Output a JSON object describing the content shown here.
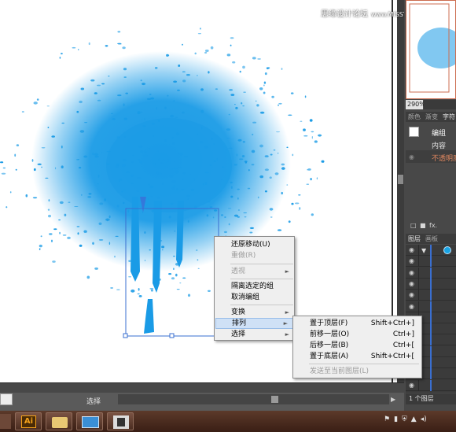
{
  "watermark": {
    "cn": "思缘设计论坛",
    "url": "www.MISSYUAN.COM"
  },
  "navigator": {
    "zoom": "290%"
  },
  "attributes_panel": {
    "tabs": [
      "颜色",
      "渐变",
      "字符",
      "字符"
    ],
    "group_label": "编组",
    "content_label": "内容",
    "opacity_label": "不透明度",
    "bottom_icons": [
      "□",
      "■",
      "fx."
    ]
  },
  "layers_panel": {
    "tabs": [
      "图层",
      "画板"
    ],
    "footer": "1 个图层"
  },
  "status_bar": {
    "tool": "选择"
  },
  "context_menu": {
    "items": [
      {
        "label": "还原移动(U)",
        "disabled": false
      },
      {
        "label": "重做(R)",
        "disabled": true
      },
      {
        "label": "透视",
        "disabled": true,
        "has_submenu": true
      },
      {
        "label": "隔离选定的组",
        "disabled": false
      },
      {
        "label": "取消编组",
        "disabled": false
      },
      {
        "label": "变换",
        "disabled": false,
        "has_submenu": true
      },
      {
        "label": "排列",
        "disabled": false,
        "has_submenu": true,
        "highlighted": true
      },
      {
        "label": "选择",
        "disabled": false,
        "has_submenu": true
      }
    ],
    "submenu_arrow": "►"
  },
  "arrange_submenu": {
    "items": [
      {
        "label": "置于顶层(F)",
        "shortcut": "Shift+Ctrl+]"
      },
      {
        "label": "前移一层(O)",
        "shortcut": "Ctrl+]"
      },
      {
        "label": "后移一层(B)",
        "shortcut": "Ctrl+["
      },
      {
        "label": "置于底层(A)",
        "shortcut": "Shift+Ctrl+["
      },
      {
        "label": "发送至当前图层(L)",
        "shortcut": "",
        "disabled": true
      }
    ]
  },
  "taskbar": {
    "apps": [
      "illustrator-app-icon",
      "folder-icon",
      "screen-app-icon",
      "photo-app-icon"
    ],
    "ai_label": "Ai"
  },
  "colors": {
    "splash": "#1a9be6",
    "accent": "#e0875f",
    "selection": "#3a6fd0"
  }
}
